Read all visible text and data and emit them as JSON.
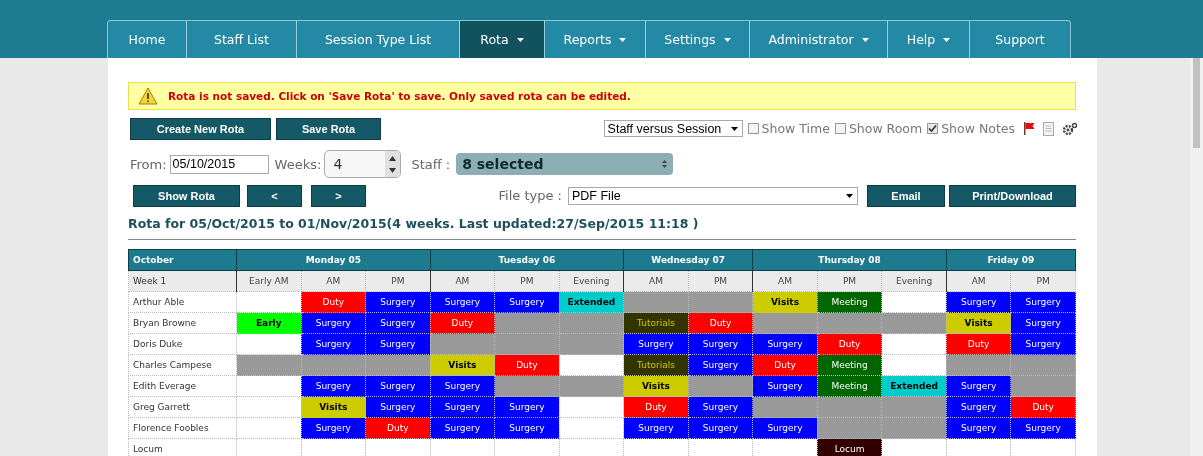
{
  "nav": [
    {
      "label": "Home",
      "selected": false,
      "dropdown": false
    },
    {
      "label": "Staff List",
      "selected": false,
      "dropdown": false
    },
    {
      "label": "Session Type List",
      "selected": false,
      "dropdown": false
    },
    {
      "label": "Rota",
      "selected": true,
      "dropdown": true
    },
    {
      "label": "Reports",
      "selected": false,
      "dropdown": true
    },
    {
      "label": "Settings",
      "selected": false,
      "dropdown": true
    },
    {
      "label": "Administrator",
      "selected": false,
      "dropdown": true
    },
    {
      "label": "Help",
      "selected": false,
      "dropdown": true
    },
    {
      "label": "Support",
      "selected": false,
      "dropdown": false
    }
  ],
  "warning": "Rota is not saved. Click on 'Save Rota' to save. Only saved rota can be edited.",
  "actions": [
    "Create New Rota",
    "Save Rota"
  ],
  "view_select": "Staff versus Session",
  "options": [
    {
      "label": "Show Time",
      "checked": false
    },
    {
      "label": "Show Room",
      "checked": false
    },
    {
      "label": "Show Notes",
      "checked": true
    }
  ],
  "from": {
    "label": "From:",
    "value": "05/10/2015"
  },
  "weeks": {
    "label": "Weeks:",
    "value": "4"
  },
  "staff": {
    "label": "Staff :",
    "value": "8 selected"
  },
  "nav_buttons": [
    "Show Rota",
    "<",
    ">"
  ],
  "file_type": {
    "label": "File type :",
    "value": "PDF File"
  },
  "export_buttons": [
    "Email",
    "Print/Download"
  ],
  "rota_title": "Rota for 05/Oct/2015 to 01/Nov/2015(4 weeks. Last updated:27/Sep/2015 11:18 )",
  "table": {
    "month": "October",
    "week": "Week 1",
    "days": [
      {
        "name": "Monday 05",
        "sessions": [
          "Early AM",
          "AM",
          "PM"
        ]
      },
      {
        "name": "Tuesday 06",
        "sessions": [
          "AM",
          "PM",
          "Evening"
        ]
      },
      {
        "name": "Wednesday 07",
        "sessions": [
          "AM",
          "PM"
        ]
      },
      {
        "name": "Thursday 08",
        "sessions": [
          "AM",
          "PM",
          "Evening"
        ]
      },
      {
        "name": "Friday 09",
        "sessions": [
          "AM",
          "PM"
        ]
      }
    ],
    "rows": [
      {
        "name": "Arthur Able",
        "cells": [
          {
            "kind": "empty"
          },
          {
            "kind": "session",
            "label": "Duty",
            "color": "#ff0000"
          },
          {
            "kind": "session",
            "label": "Surgery",
            "color": "#0000ff"
          },
          {
            "kind": "session",
            "label": "Surgery",
            "color": "#0000ff"
          },
          {
            "kind": "session",
            "label": "Surgery",
            "color": "#0000ff"
          },
          {
            "kind": "session",
            "label": "Extended",
            "color": "#00cccc"
          },
          {
            "kind": "unavailable"
          },
          {
            "kind": "unavailable"
          },
          {
            "kind": "session",
            "label": "Visits",
            "color": "#cccc00"
          },
          {
            "kind": "session",
            "label": "Meeting",
            "color": "#006600"
          },
          {
            "kind": "empty"
          },
          {
            "kind": "session",
            "label": "Surgery",
            "color": "#0000ff"
          },
          {
            "kind": "session",
            "label": "Surgery",
            "color": "#0000ff"
          }
        ]
      },
      {
        "name": "Bryan Browne",
        "cells": [
          {
            "kind": "session",
            "label": "Early",
            "color": "#00ff00"
          },
          {
            "kind": "session",
            "label": "Surgery",
            "color": "#0000ff"
          },
          {
            "kind": "session",
            "label": "Surgery",
            "color": "#0000ff"
          },
          {
            "kind": "session",
            "label": "Duty",
            "color": "#ff0000"
          },
          {
            "kind": "unavailable"
          },
          {
            "kind": "unavailable"
          },
          {
            "kind": "session",
            "label": "Tutorials",
            "color": "#333300"
          },
          {
            "kind": "session",
            "label": "Duty",
            "color": "#ff0000"
          },
          {
            "kind": "unavailable"
          },
          {
            "kind": "unavailable"
          },
          {
            "kind": "unavailable"
          },
          {
            "kind": "session",
            "label": "Visits",
            "color": "#cccc00"
          },
          {
            "kind": "session",
            "label": "Surgery",
            "color": "#0000ff"
          }
        ]
      },
      {
        "name": "Doris Duke",
        "cells": [
          {
            "kind": "empty"
          },
          {
            "kind": "session",
            "label": "Surgery",
            "color": "#0000ff"
          },
          {
            "kind": "session",
            "label": "Surgery",
            "color": "#0000ff"
          },
          {
            "kind": "unavailable"
          },
          {
            "kind": "unavailable"
          },
          {
            "kind": "unavailable"
          },
          {
            "kind": "session",
            "label": "Surgery",
            "color": "#0000ff"
          },
          {
            "kind": "session",
            "label": "Surgery",
            "color": "#0000ff"
          },
          {
            "kind": "session",
            "label": "Surgery",
            "color": "#0000ff"
          },
          {
            "kind": "session",
            "label": "Duty",
            "color": "#ff0000"
          },
          {
            "kind": "empty"
          },
          {
            "kind": "session",
            "label": "Duty",
            "color": "#ff0000"
          },
          {
            "kind": "session",
            "label": "Surgery",
            "color": "#0000ff"
          }
        ]
      },
      {
        "name": "Charles Campese",
        "cells": [
          {
            "kind": "unavailable"
          },
          {
            "kind": "unavailable"
          },
          {
            "kind": "unavailable"
          },
          {
            "kind": "session",
            "label": "Visits",
            "color": "#cccc00"
          },
          {
            "kind": "session",
            "label": "Duty",
            "color": "#ff0000"
          },
          {
            "kind": "empty"
          },
          {
            "kind": "session",
            "label": "Tutorials",
            "color": "#333300"
          },
          {
            "kind": "session",
            "label": "Surgery",
            "color": "#0000ff"
          },
          {
            "kind": "session",
            "label": "Duty",
            "color": "#ff0000"
          },
          {
            "kind": "session",
            "label": "Meeting",
            "color": "#006600"
          },
          {
            "kind": "empty"
          },
          {
            "kind": "unavailable"
          },
          {
            "kind": "unavailable"
          }
        ]
      },
      {
        "name": "Edith Everage",
        "cells": [
          {
            "kind": "empty"
          },
          {
            "kind": "session",
            "label": "Surgery",
            "color": "#0000ff"
          },
          {
            "kind": "session",
            "label": "Surgery",
            "color": "#0000ff"
          },
          {
            "kind": "session",
            "label": "Surgery",
            "color": "#0000ff"
          },
          {
            "kind": "unavailable"
          },
          {
            "kind": "unavailable"
          },
          {
            "kind": "session",
            "label": "Visits",
            "color": "#cccc00"
          },
          {
            "kind": "unavailable"
          },
          {
            "kind": "session",
            "label": "Surgery",
            "color": "#0000ff"
          },
          {
            "kind": "session",
            "label": "Meeting",
            "color": "#006600"
          },
          {
            "kind": "session",
            "label": "Extended",
            "color": "#00cccc"
          },
          {
            "kind": "session",
            "label": "Surgery",
            "color": "#0000ff"
          },
          {
            "kind": "unavailable"
          }
        ]
      },
      {
        "name": "Greg Garrett",
        "cells": [
          {
            "kind": "empty"
          },
          {
            "kind": "session",
            "label": "Visits",
            "color": "#cccc00"
          },
          {
            "kind": "session",
            "label": "Surgery",
            "color": "#0000ff"
          },
          {
            "kind": "session",
            "label": "Surgery",
            "color": "#0000ff"
          },
          {
            "kind": "session",
            "label": "Surgery",
            "color": "#0000ff"
          },
          {
            "kind": "empty"
          },
          {
            "kind": "session",
            "label": "Duty",
            "color": "#ff0000"
          },
          {
            "kind": "session",
            "label": "Surgery",
            "color": "#0000ff"
          },
          {
            "kind": "unavailable"
          },
          {
            "kind": "unavailable"
          },
          {
            "kind": "unavailable"
          },
          {
            "kind": "session",
            "label": "Surgery",
            "color": "#0000ff"
          },
          {
            "kind": "session",
            "label": "Duty",
            "color": "#ff0000"
          }
        ]
      },
      {
        "name": "Florence Foobles",
        "cells": [
          {
            "kind": "empty"
          },
          {
            "kind": "session",
            "label": "Surgery",
            "color": "#0000ff"
          },
          {
            "kind": "session",
            "label": "Duty",
            "color": "#ff0000"
          },
          {
            "kind": "session",
            "label": "Surgery",
            "color": "#0000ff"
          },
          {
            "kind": "session",
            "label": "Surgery",
            "color": "#0000ff"
          },
          {
            "kind": "empty"
          },
          {
            "kind": "session",
            "label": "Surgery",
            "color": "#0000ff"
          },
          {
            "kind": "session",
            "label": "Surgery",
            "color": "#0000ff"
          },
          {
            "kind": "session",
            "label": "Surgery",
            "color": "#0000ff"
          },
          {
            "kind": "unavailable"
          },
          {
            "kind": "unavailable"
          },
          {
            "kind": "session",
            "label": "Surgery",
            "color": "#0000ff"
          },
          {
            "kind": "session",
            "label": "Surgery",
            "color": "#0000ff"
          }
        ]
      },
      {
        "name": "Locum",
        "cells": [
          {
            "kind": "empty"
          },
          {
            "kind": "empty"
          },
          {
            "kind": "empty"
          },
          {
            "kind": "empty"
          },
          {
            "kind": "empty"
          },
          {
            "kind": "empty"
          },
          {
            "kind": "empty"
          },
          {
            "kind": "empty"
          },
          {
            "kind": "empty"
          },
          {
            "kind": "session",
            "label": "Locum",
            "color": "#330000"
          },
          {
            "kind": "empty"
          },
          {
            "kind": "empty"
          },
          {
            "kind": "empty"
          }
        ]
      }
    ]
  }
}
